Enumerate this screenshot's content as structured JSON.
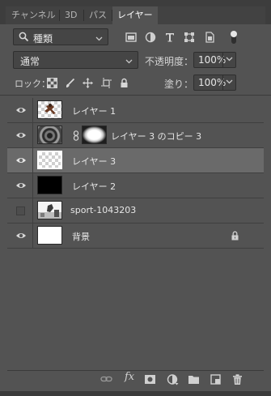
{
  "tabs": [
    {
      "label": "チャンネル",
      "active": false
    },
    {
      "label": "3D",
      "active": false
    },
    {
      "label": "パス",
      "active": false
    },
    {
      "label": "レイヤー",
      "active": true
    }
  ],
  "filter": {
    "kind_value": "種類",
    "filter_icons": [
      "image-filter-icon",
      "adjustment-filter-icon",
      "type-filter-icon",
      "shape-filter-icon",
      "smart-object-filter-icon",
      "filter-toggle-icon"
    ]
  },
  "blend": {
    "mode_value": "通常",
    "opacity_label": "不透明度：",
    "opacity_value": "100%"
  },
  "lock": {
    "label": "ロック：",
    "icons": [
      "lock-transparent-icon",
      "lock-paint-icon",
      "lock-position-icon",
      "lock-artboard-icon",
      "lock-all-icon"
    ],
    "fill_label": "塗り：",
    "fill_value": "100%"
  },
  "layers": [
    {
      "name": "レイヤー 1",
      "visible": true,
      "selected": false,
      "thumb": "checker-figure"
    },
    {
      "name": "レイヤー 3 のコピー 3",
      "visible": true,
      "selected": false,
      "thumb": "swirl",
      "mask": true
    },
    {
      "name": "レイヤー 3",
      "visible": true,
      "selected": true,
      "thumb": "checker-selected"
    },
    {
      "name": "レイヤー 2",
      "visible": true,
      "selected": false,
      "thumb": "black"
    },
    {
      "name": "sport-1043203",
      "visible": false,
      "selected": false,
      "thumb": "photo"
    },
    {
      "name": "背景",
      "visible": true,
      "selected": false,
      "thumb": "white",
      "locked": true
    }
  ],
  "footer_icons": [
    "link-layers-icon",
    "fx-icon",
    "add-mask-icon",
    "adjustment-layer-icon",
    "new-group-icon",
    "new-layer-icon",
    "trash-icon"
  ],
  "footer": {
    "fx_label": "fx"
  }
}
